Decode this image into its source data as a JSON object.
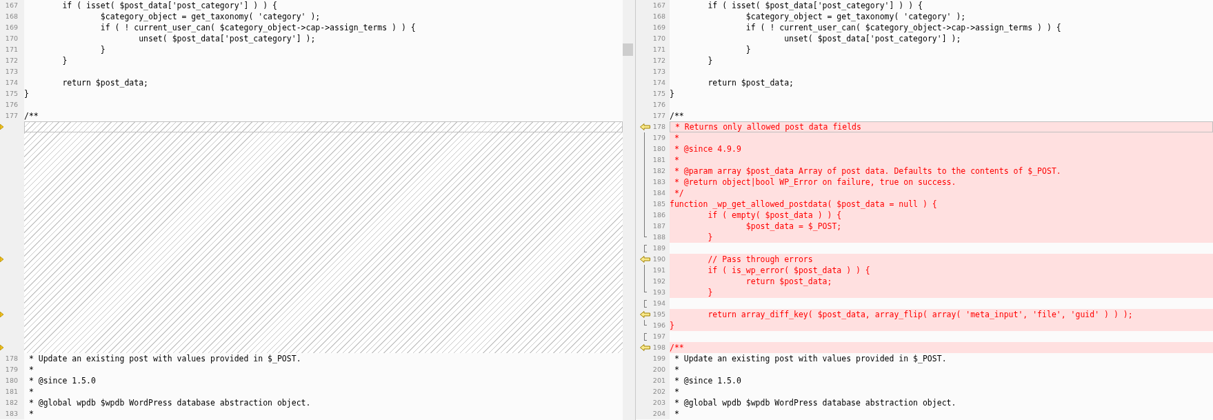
{
  "left_pane": {
    "lines": [
      {
        "number": "167",
        "text": "\tif ( isset( $post_data['post_category'] ) ) {",
        "kind": "code",
        "current": false,
        "marker": false
      },
      {
        "number": "168",
        "text": "\t\t$category_object = get_taxonomy( 'category' );",
        "kind": "code",
        "current": false,
        "marker": false
      },
      {
        "number": "169",
        "text": "\t\tif ( ! current_user_can( $category_object->cap->assign_terms ) ) {",
        "kind": "code",
        "current": false,
        "marker": false
      },
      {
        "number": "170",
        "text": "\t\t\tunset( $post_data['post_category'] );",
        "kind": "code",
        "current": false,
        "marker": false
      },
      {
        "number": "171",
        "text": "\t\t}",
        "kind": "code",
        "current": false,
        "marker": false
      },
      {
        "number": "172",
        "text": "\t}",
        "kind": "code",
        "current": false,
        "marker": false
      },
      {
        "number": "173",
        "kind": "code",
        "current": false,
        "marker": false
      },
      {
        "number": "174",
        "text": "\treturn $post_data;",
        "kind": "code",
        "current": false,
        "marker": false
      },
      {
        "number": "175",
        "text": "}",
        "kind": "code",
        "current": false,
        "marker": false
      },
      {
        "number": "176",
        "kind": "code",
        "current": false,
        "marker": false
      },
      {
        "number": "177",
        "text": "/**",
        "kind": "code",
        "current": false,
        "marker": false
      },
      {
        "kind": "filler",
        "current": true,
        "marker": true
      },
      {
        "kind": "filler",
        "current": false,
        "marker": false
      },
      {
        "kind": "filler",
        "current": false,
        "marker": false
      },
      {
        "kind": "filler",
        "current": false,
        "marker": false
      },
      {
        "kind": "filler",
        "current": false,
        "marker": false
      },
      {
        "kind": "filler",
        "current": false,
        "marker": false
      },
      {
        "kind": "filler",
        "current": false,
        "marker": false
      },
      {
        "kind": "filler",
        "current": false,
        "marker": false
      },
      {
        "kind": "filler",
        "current": false,
        "marker": false
      },
      {
        "kind": "filler",
        "current": false,
        "marker": false
      },
      {
        "kind": "filler",
        "current": false,
        "marker": false
      },
      {
        "kind": "filler",
        "current": false,
        "marker": false
      },
      {
        "kind": "filler",
        "current": false,
        "marker": true
      },
      {
        "kind": "filler",
        "current": false,
        "marker": false
      },
      {
        "kind": "filler",
        "current": false,
        "marker": false
      },
      {
        "kind": "filler",
        "current": false,
        "marker": false
      },
      {
        "kind": "filler",
        "current": false,
        "marker": false
      },
      {
        "kind": "filler",
        "current": false,
        "marker": true
      },
      {
        "kind": "filler",
        "current": false,
        "marker": false
      },
      {
        "kind": "filler",
        "current": false,
        "marker": false
      },
      {
        "kind": "filler",
        "current": false,
        "marker": true
      },
      {
        "number": "178",
        "text": " * Update an existing post with values provided in $_POST.",
        "kind": "code",
        "current": false,
        "marker": false
      },
      {
        "number": "179",
        "text": " *",
        "kind": "code",
        "current": false,
        "marker": false
      },
      {
        "number": "180",
        "text": " * @since 1.5.0",
        "kind": "code",
        "current": false,
        "marker": false
      },
      {
        "number": "181",
        "text": " *",
        "kind": "code",
        "current": false,
        "marker": false
      },
      {
        "number": "182",
        "text": " * @global wpdb $wpdb WordPress database abstraction object.",
        "kind": "code",
        "current": false,
        "marker": false
      },
      {
        "number": "183",
        "text": " *",
        "kind": "code",
        "current": false,
        "marker": false
      }
    ]
  },
  "right_pane": {
    "lines": [
      {
        "number": "167",
        "text": "\tif ( isset( $post_data['post_category'] ) ) {",
        "kind": "code",
        "current": false,
        "marker": false
      },
      {
        "number": "168",
        "text": "\t\t$category_object = get_taxonomy( 'category' );",
        "kind": "code",
        "current": false,
        "marker": false
      },
      {
        "number": "169",
        "text": "\t\tif ( ! current_user_can( $category_object->cap->assign_terms ) ) {",
        "kind": "code",
        "current": false,
        "marker": false
      },
      {
        "number": "170",
        "text": "\t\t\tunset( $post_data['post_category'] );",
        "kind": "code",
        "current": false,
        "marker": false
      },
      {
        "number": "171",
        "text": "\t\t}",
        "kind": "code",
        "current": false,
        "marker": false
      },
      {
        "number": "172",
        "text": "\t}",
        "kind": "code",
        "current": false,
        "marker": false
      },
      {
        "number": "173",
        "kind": "code",
        "current": false,
        "marker": false
      },
      {
        "number": "174",
        "text": "\treturn $post_data;",
        "kind": "code",
        "current": false,
        "marker": false
      },
      {
        "number": "175",
        "text": "}",
        "kind": "code",
        "current": false,
        "marker": false
      },
      {
        "number": "176",
        "kind": "code",
        "current": false,
        "marker": false
      },
      {
        "number": "177",
        "text": "/**",
        "kind": "code",
        "current": false,
        "marker": false
      },
      {
        "number": "178",
        "text": " * Returns only allowed post data fields",
        "kind": "added",
        "current": true,
        "marker": true
      },
      {
        "number": "179",
        "text": " *",
        "kind": "added",
        "current": false,
        "marker": false,
        "gutter": {
          "kind": "line"
        }
      },
      {
        "number": "180",
        "text": " * @since 4.9.9",
        "kind": "added",
        "current": false,
        "marker": false,
        "gutter": {
          "kind": "line"
        }
      },
      {
        "number": "181",
        "text": " *",
        "kind": "added",
        "current": false,
        "marker": false,
        "gutter": {
          "kind": "line"
        }
      },
      {
        "number": "182",
        "text": " * @param array $post_data Array of post data. Defaults to the contents of $_POST.",
        "kind": "added",
        "current": false,
        "marker": false,
        "gutter": {
          "kind": "line"
        }
      },
      {
        "number": "183",
        "text": " * @return object|bool WP_Error on failure, true on success.",
        "kind": "added",
        "current": false,
        "marker": false,
        "gutter": {
          "kind": "line"
        }
      },
      {
        "number": "184",
        "text": " */",
        "kind": "added",
        "current": false,
        "marker": false,
        "gutter": {
          "kind": "line"
        }
      },
      {
        "number": "185",
        "text": "function _wp_get_allowed_postdata( $post_data = null ) {",
        "kind": "added",
        "current": false,
        "marker": false,
        "gutter": {
          "kind": "line"
        }
      },
      {
        "number": "186",
        "text": "\tif ( empty( $post_data ) ) {",
        "kind": "added",
        "current": false,
        "marker": false,
        "gutter": {
          "kind": "line"
        }
      },
      {
        "number": "187",
        "text": "\t\t$post_data = $_POST;",
        "kind": "added",
        "current": false,
        "marker": false,
        "gutter": {
          "kind": "line"
        }
      },
      {
        "number": "188",
        "text": "\t}",
        "kind": "added",
        "current": false,
        "marker": false,
        "gutter": {
          "kind": "end"
        }
      },
      {
        "number": "189",
        "kind": "code",
        "current": false,
        "marker": false,
        "gutter": {
          "kind": "open"
        }
      },
      {
        "number": "190",
        "text": "\t// Pass through errors",
        "kind": "added",
        "current": false,
        "marker": true
      },
      {
        "number": "191",
        "text": "\tif ( is_wp_error( $post_data ) ) {",
        "kind": "added",
        "current": false,
        "marker": false,
        "gutter": {
          "kind": "line"
        }
      },
      {
        "number": "192",
        "text": "\t\treturn $post_data;",
        "kind": "added",
        "current": false,
        "marker": false,
        "gutter": {
          "kind": "line"
        }
      },
      {
        "number": "193",
        "text": "\t}",
        "kind": "added",
        "current": false,
        "marker": false,
        "gutter": {
          "kind": "end"
        }
      },
      {
        "number": "194",
        "kind": "code",
        "current": false,
        "marker": false,
        "gutter": {
          "kind": "open"
        }
      },
      {
        "number": "195",
        "text": "\treturn array_diff_key( $post_data, array_flip( array( 'meta_input', 'file', 'guid' ) ) );",
        "kind": "added",
        "current": false,
        "marker": true
      },
      {
        "number": "196",
        "text": "}",
        "kind": "added",
        "current": false,
        "marker": false,
        "gutter": {
          "kind": "end"
        }
      },
      {
        "number": "197",
        "kind": "code",
        "current": false,
        "marker": false,
        "gutter": {
          "kind": "open"
        }
      },
      {
        "number": "198",
        "text": "/**",
        "kind": "added",
        "current": false,
        "marker": true
      },
      {
        "number": "199",
        "text": " * Update an existing post with values provided in $_POST.",
        "kind": "code",
        "current": false,
        "marker": false
      },
      {
        "number": "200",
        "text": " *",
        "kind": "code",
        "current": false,
        "marker": false
      },
      {
        "number": "201",
        "text": " * @since 1.5.0",
        "kind": "code",
        "current": false,
        "marker": false
      },
      {
        "number": "202",
        "text": " *",
        "kind": "code",
        "current": false,
        "marker": false
      },
      {
        "number": "203",
        "text": " * @global wpdb $wpdb WordPress database abstraction object.",
        "kind": "code",
        "current": false,
        "marker": false
      },
      {
        "number": "204",
        "text": " *",
        "kind": "code",
        "current": false,
        "marker": false
      }
    ]
  }
}
